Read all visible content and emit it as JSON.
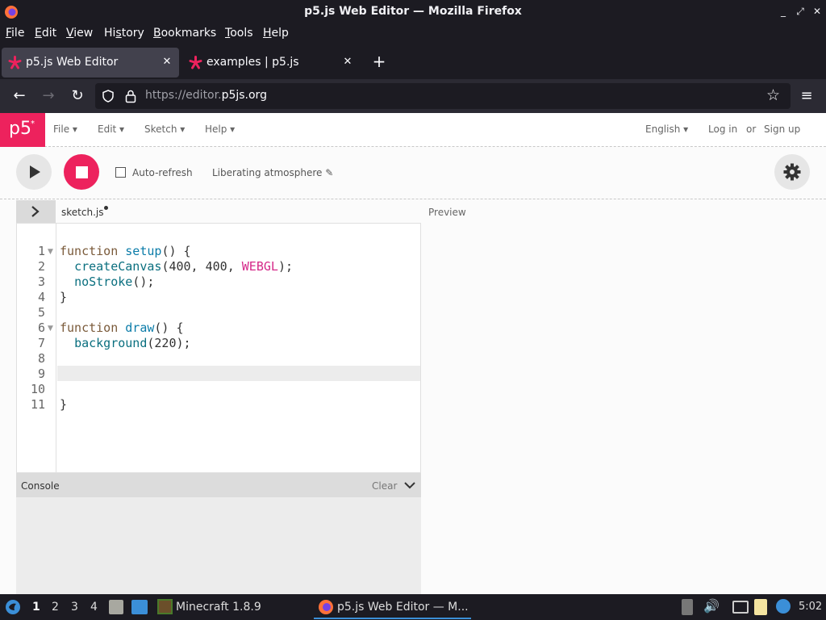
{
  "window": {
    "title": "p5.js Web Editor — Mozilla Firefox"
  },
  "menubar": {
    "items": [
      {
        "label": "File",
        "u": "F",
        "rest": "ile"
      },
      {
        "label": "Edit",
        "u": "E",
        "rest": "dit"
      },
      {
        "label": "View",
        "u": "V",
        "rest": "iew"
      },
      {
        "label": "History",
        "u": "s",
        "pre": "Hi",
        "rest": "tory"
      },
      {
        "label": "Bookmarks",
        "u": "B",
        "rest": "ookmarks"
      },
      {
        "label": "Tools",
        "u": "T",
        "rest": "ools"
      },
      {
        "label": "Help",
        "u": "H",
        "rest": "elp"
      }
    ]
  },
  "tabs": [
    {
      "label": "p5.js Web Editor",
      "active": true
    },
    {
      "label": "examples | p5.js",
      "active": false
    }
  ],
  "url": {
    "prefix": "https://editor.",
    "domain": "p5js.org"
  },
  "p5": {
    "logo": "p5",
    "menus": [
      "File ▾",
      "Edit ▾",
      "Sketch ▾",
      "Help ▾"
    ],
    "language": "English ▾",
    "login": "Log in",
    "or": "or",
    "signup": "Sign up",
    "autorefresh": "Auto-refresh",
    "sketch_name": "Liberating atmosphere",
    "file_tab": "sketch.js",
    "preview": "Preview",
    "console": "Console",
    "clear": "Clear"
  },
  "code_lines": [
    "1",
    "2",
    "3",
    "4",
    "5",
    "6",
    "7",
    "8",
    "9",
    "10",
    "11"
  ],
  "taskbar": {
    "workspaces": [
      "1",
      "2",
      "3",
      "4"
    ],
    "minecraft": "Minecraft 1.8.9",
    "firefox": "p5.js Web Editor — M...",
    "clock": "5:02"
  },
  "colors": {
    "p5_pink": "#ed225d",
    "firefox_dark": "#1c1b22"
  }
}
